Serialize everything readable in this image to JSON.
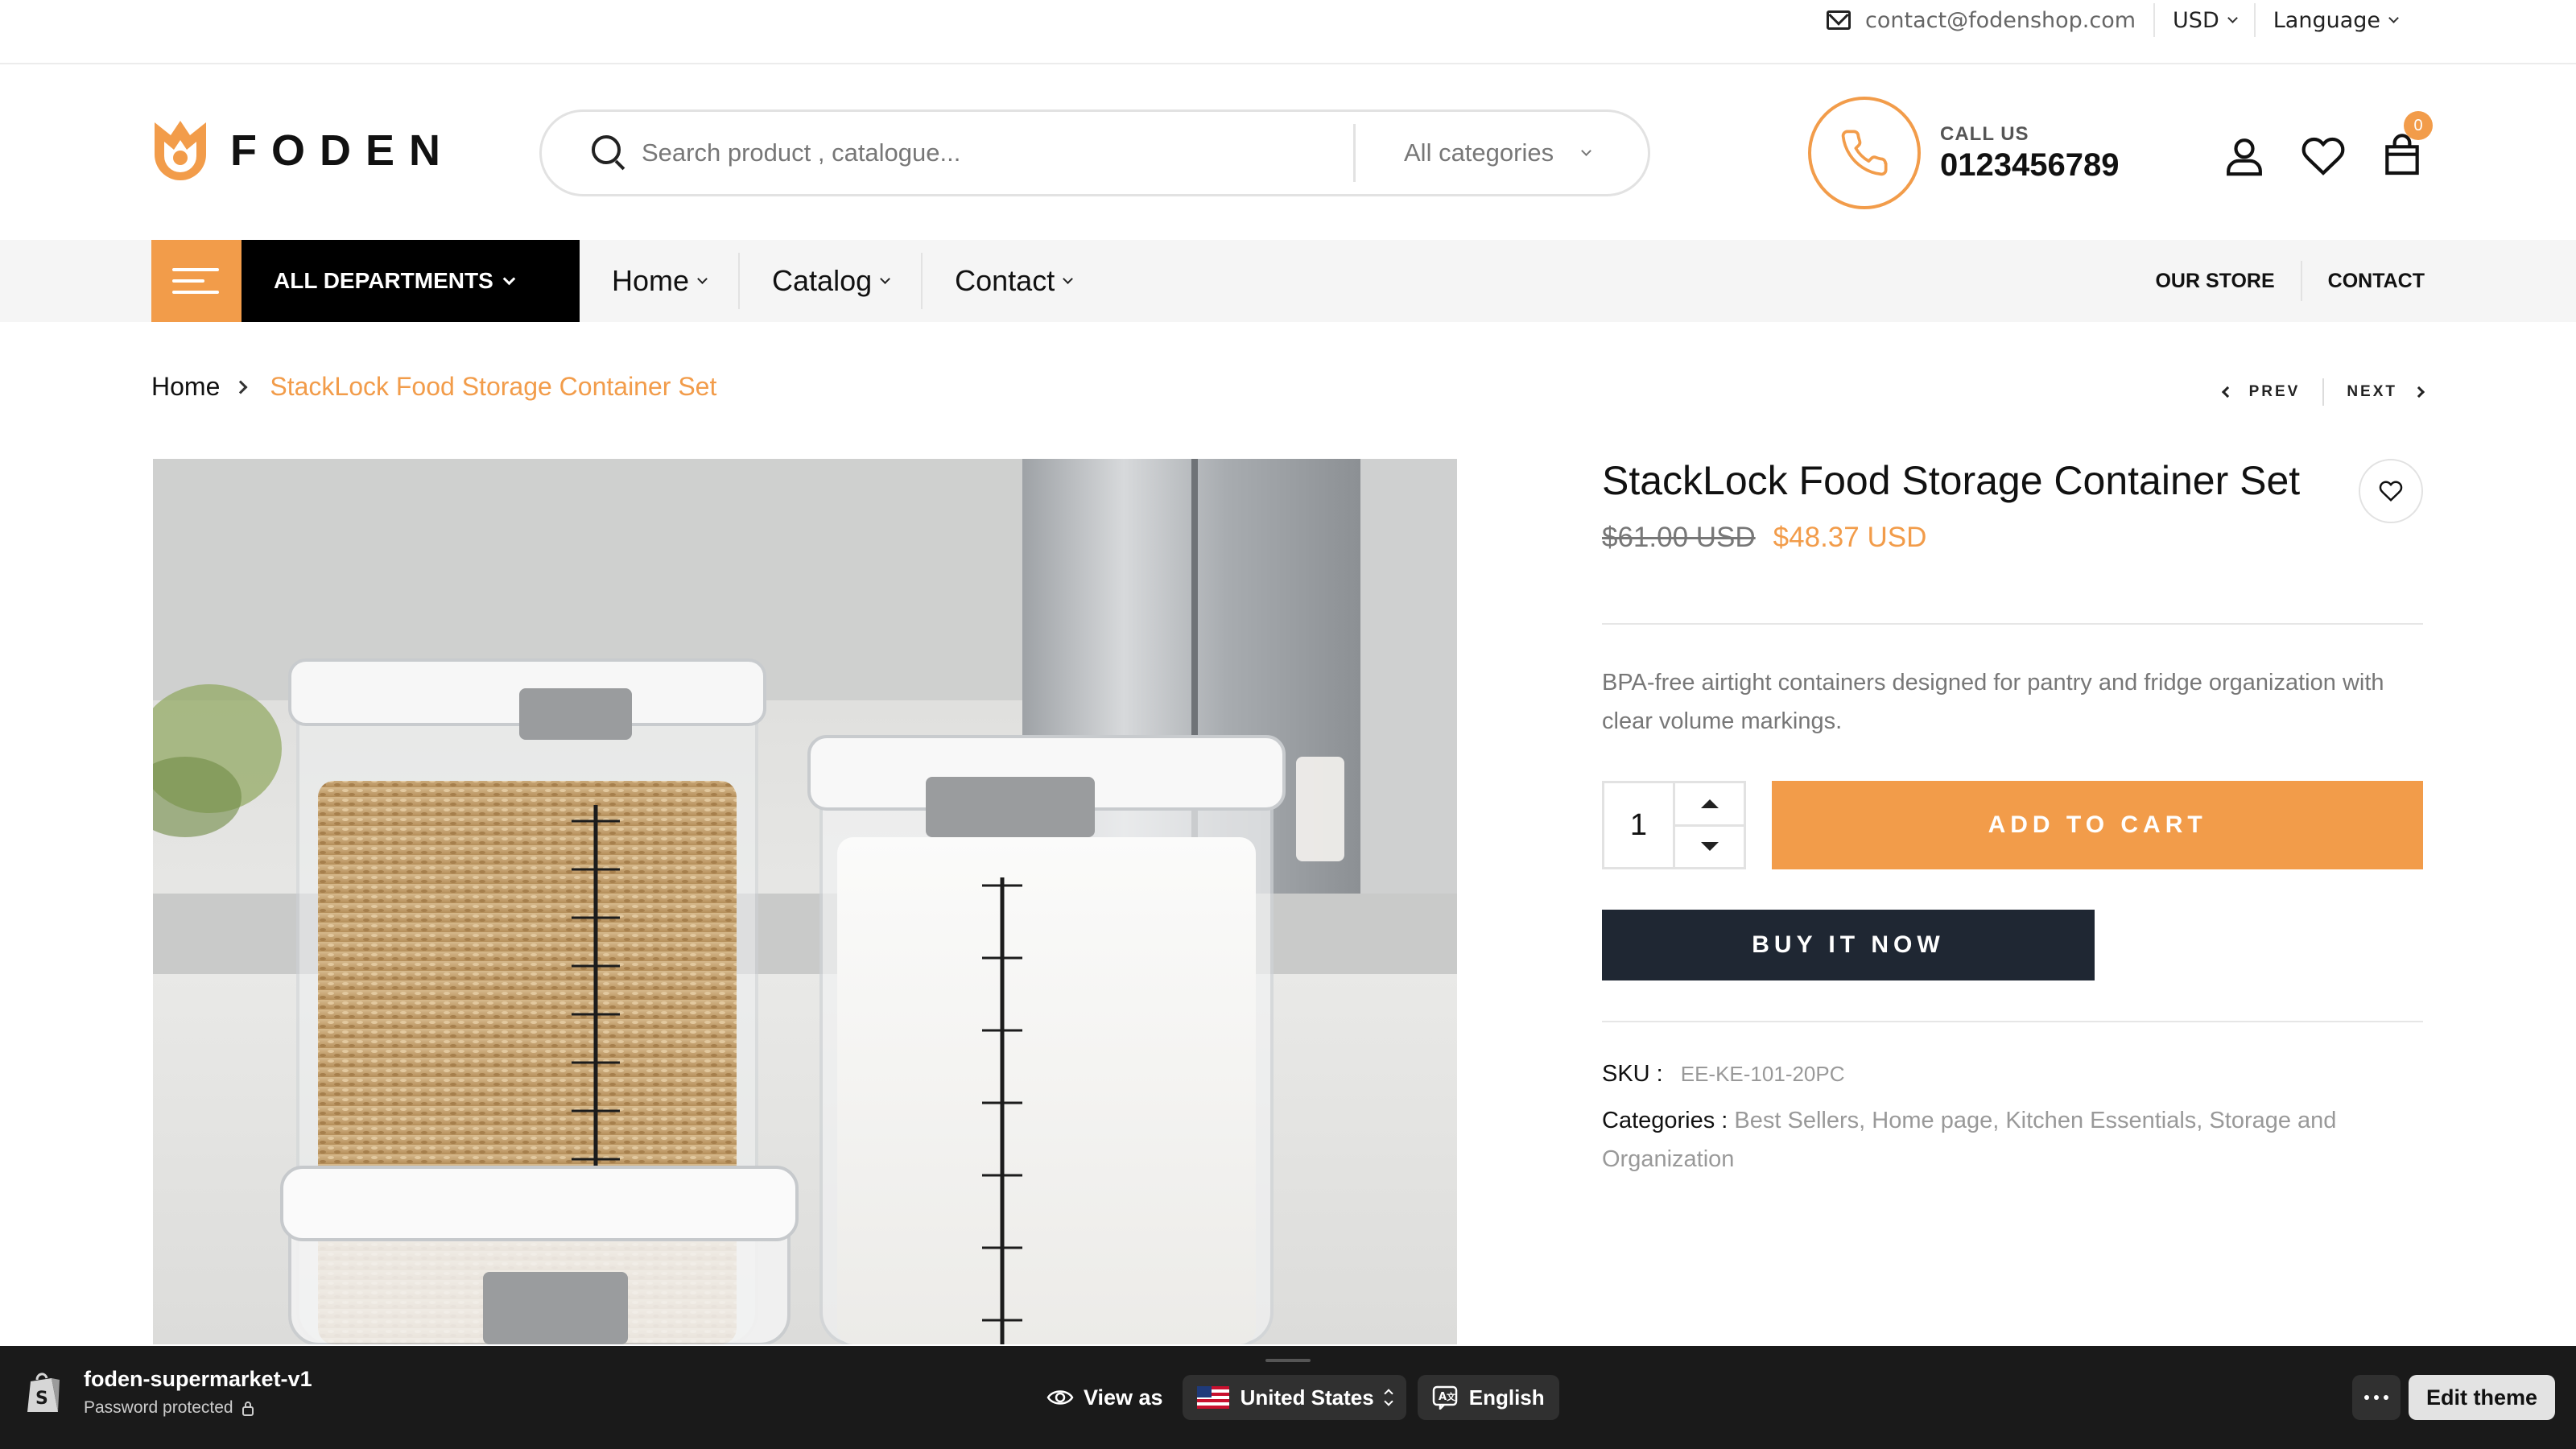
{
  "topbar": {
    "email": "contact@fodenshop.com",
    "currency": "USD",
    "language": "Language"
  },
  "header": {
    "logo_text": "FODEN",
    "search": {
      "placeholder": "Search product , catalogue...",
      "category": "All categories"
    },
    "call_us": {
      "label": "CALL US",
      "number": "0123456789"
    },
    "cart_count": "0"
  },
  "nav": {
    "departments_label": "ALL DEPARTMENTS",
    "links": [
      {
        "label": "Home"
      },
      {
        "label": "Catalog"
      },
      {
        "label": "Contact"
      }
    ],
    "right_links": [
      {
        "label": "OUR STORE"
      },
      {
        "label": "CONTACT"
      }
    ]
  },
  "breadcrumb": {
    "home": "Home",
    "current": "StackLock Food Storage Container Set"
  },
  "pager": {
    "prev": "PREV",
    "next": "NEXT"
  },
  "product": {
    "title": "StackLock Food Storage Container Set",
    "old_price": "$61.00 USD",
    "new_price": "$48.37 USD",
    "description": "BPA-free airtight containers designed for pantry and fridge organization with clear volume markings.",
    "quantity": "1",
    "add_to_cart": "ADD TO CART",
    "buy_now": "BUY IT NOW",
    "sku_label": "SKU :",
    "sku_value": "EE-KE-101-20PC",
    "categories_label": "Categories :",
    "categories": [
      "Best Sellers,",
      "Home page,",
      "Kitchen Essentials,",
      "Storage and Organization"
    ]
  },
  "preview_bar": {
    "store_name": "foden-supermarket-v1",
    "status": "Password protected",
    "view_as": "View as",
    "country": "United States",
    "language": "English",
    "edit_theme": "Edit theme"
  },
  "colors": {
    "accent": "#f29c4a",
    "dark_button": "#1f2733",
    "preview_bar": "#1a1a1a"
  }
}
